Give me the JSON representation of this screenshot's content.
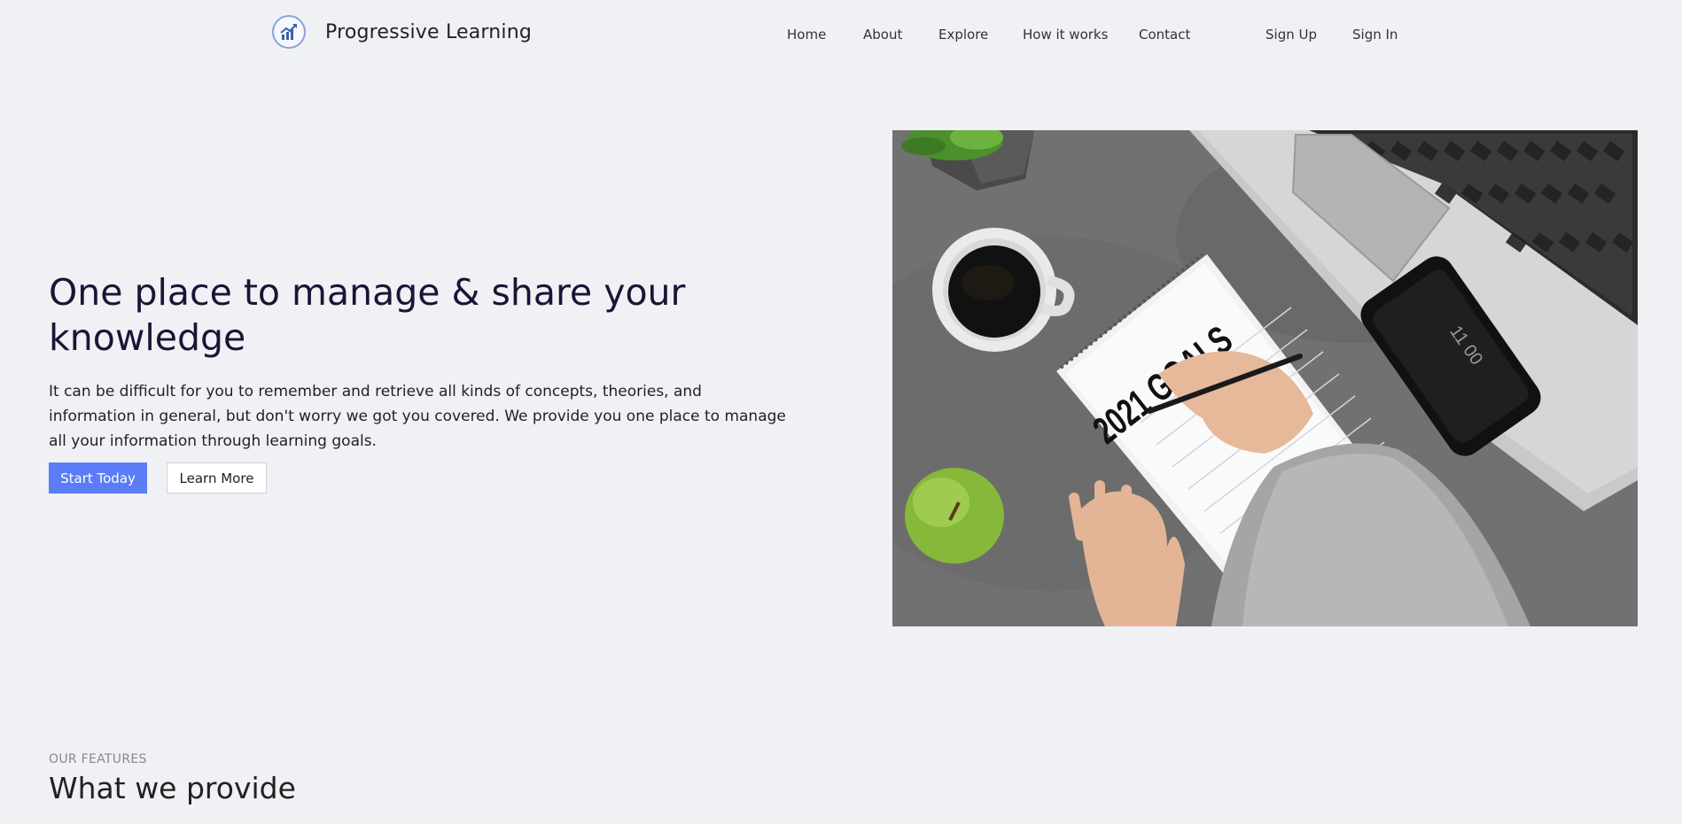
{
  "header": {
    "brand": "Progressive Learning",
    "logo_icon": "trending-up-chart-icon",
    "nav": [
      "Home",
      "About",
      "Explore",
      "How it works",
      "Contact"
    ],
    "auth": [
      "Sign Up",
      "Sign In"
    ]
  },
  "hero": {
    "title": "One place to manage & share your knowledge",
    "description": "It can be difficult for you to remember and retrieve all kinds of concepts, theories, and information in general, but don't worry we got you covered. We provide you one place to manage all your information through learning goals.",
    "primary_button": "Start Today",
    "secondary_button": "Learn More",
    "image": {
      "notebook_text": "2021 GOALS",
      "phone_time": "11 00"
    }
  },
  "features": {
    "eyebrow": "OUR FEATURES",
    "title": "What we provide"
  },
  "colors": {
    "background": "#f0f1f5",
    "primary": "#5b7cf6",
    "heading": "#1c1436"
  }
}
